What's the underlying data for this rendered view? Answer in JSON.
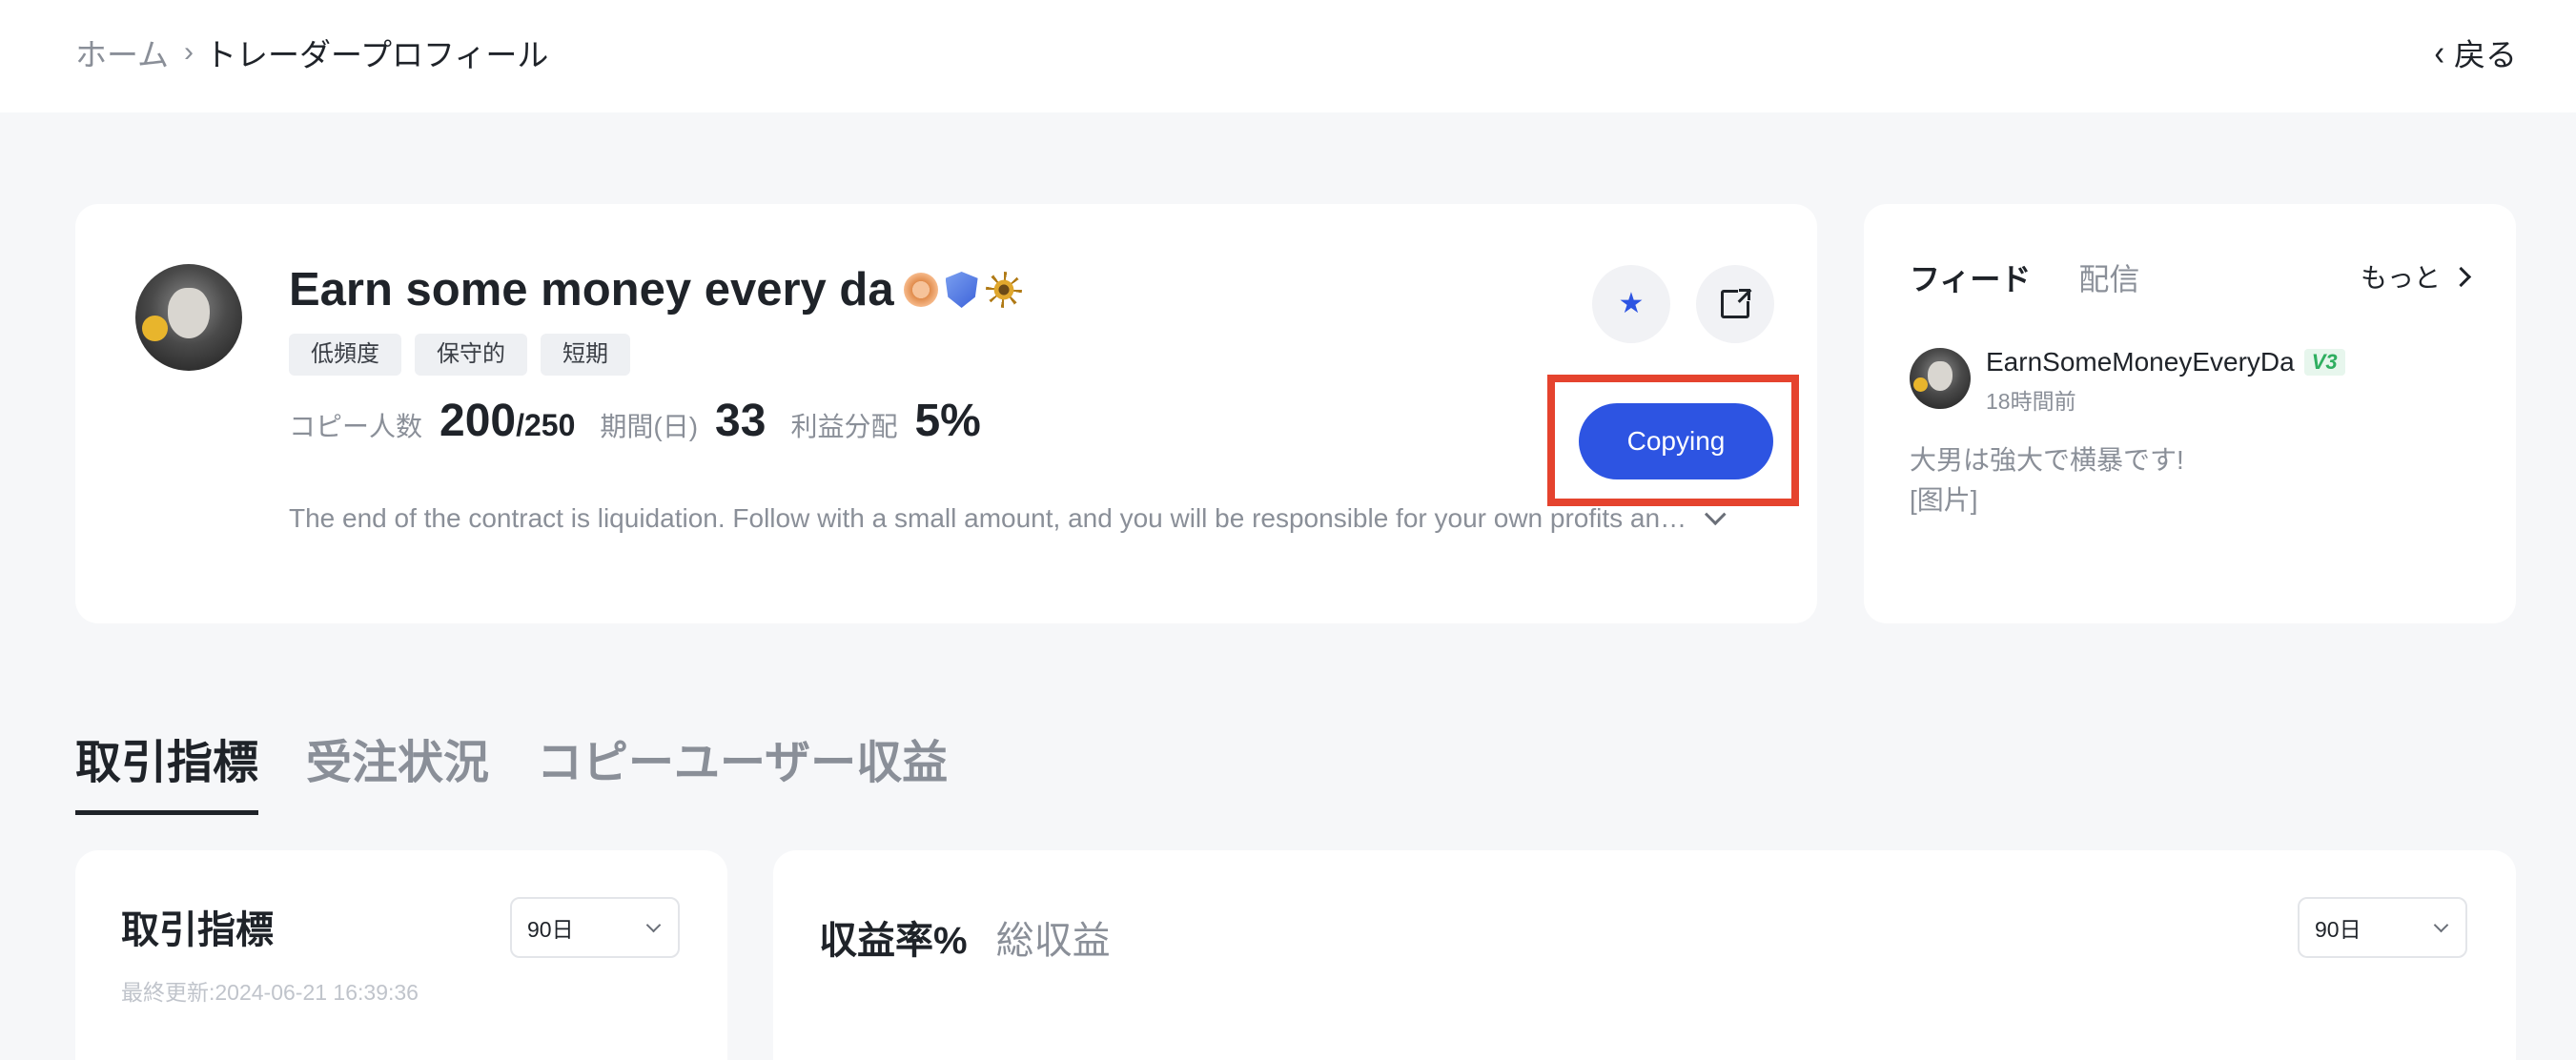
{
  "breadcrumb": {
    "home": "ホーム",
    "separator": "›",
    "current": "トレーダープロフィール"
  },
  "back": {
    "label": "戻る"
  },
  "profile": {
    "name": "Earn some money every da",
    "badges": [
      "bronze-medal-icon",
      "shield-icon",
      "ship-wheel-icon"
    ],
    "tags": [
      "低頻度",
      "保守的",
      "短期"
    ],
    "copiers_label": "コピー人数",
    "copiers_value": "200",
    "copiers_total": "/250",
    "period_label": "期間(日)",
    "period_value": "33",
    "profit_share_label": "利益分配",
    "profit_share_value": "5%",
    "bio": "The end of the contract is liquidation. Follow with a small amount, and you will be responsible for your own profits an…",
    "copy_button": "Copying"
  },
  "feed": {
    "tabs": [
      "フィード",
      "配信"
    ],
    "more": "もっと",
    "post": {
      "author": "EarnSomeMoneyEveryDa",
      "vip": "V3",
      "time": "18時間前",
      "text_line1": "大男は強大で横暴です!",
      "text_line2": "[图片]"
    }
  },
  "main_tabs": [
    "取引指標",
    "受注状況",
    "コピーユーザー収益"
  ],
  "metrics": {
    "title": "取引指標",
    "updated": "最終更新:2024-06-21 16:39:36",
    "range": "90日"
  },
  "returns": {
    "tabs": [
      "収益率%",
      "総収益"
    ],
    "range": "90日"
  },
  "colors": {
    "accent": "#2d54e2",
    "highlight": "#e5432e",
    "background": "#f6f7f9",
    "muted_text": "#8a8f98"
  }
}
